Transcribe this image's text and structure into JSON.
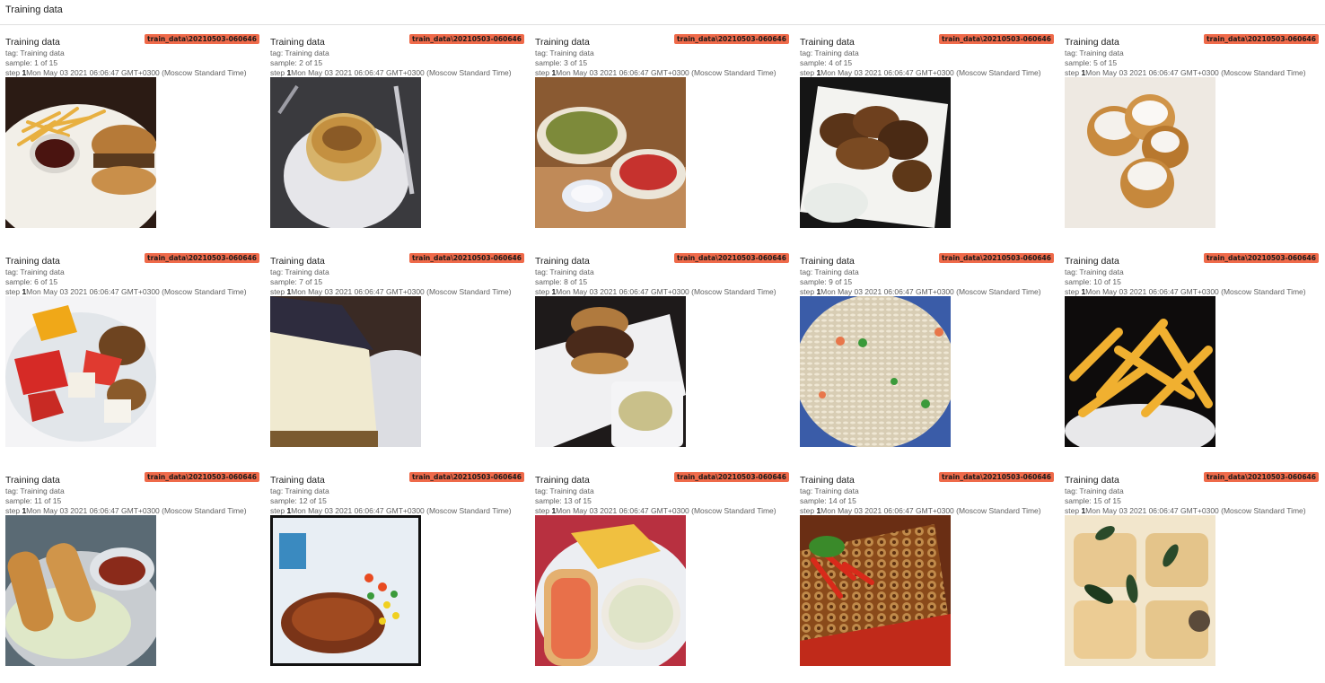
{
  "page": {
    "title": "Training data"
  },
  "cards": [
    {
      "title": "Training data",
      "run": "train_data\\20210503-060646",
      "tag": "tag: Training data",
      "sample": "sample: 1 of 15",
      "step_label": "step ",
      "step_value": "1",
      "timestamp": "Mon May 03 2021 06:06:47 GMT+0300 (Moscow Standard Time)",
      "image": "burger-and-fries-image"
    },
    {
      "title": "Training data",
      "run": "train_data\\20210503-060646",
      "tag": "tag: Training data",
      "sample": "sample: 2 of 15",
      "step_label": "step ",
      "step_value": "1",
      "timestamp": "Mon May 03 2021 06:06:47 GMT+0300 (Moscow Standard Time)",
      "image": "onion-soup-image"
    },
    {
      "title": "Training data",
      "run": "train_data\\20210503-060646",
      "tag": "tag: Training data",
      "sample": "sample: 3 of 15",
      "step_label": "step ",
      "step_value": "1",
      "timestamp": "Mon May 03 2021 06:06:47 GMT+0300 (Moscow Standard Time)",
      "image": "salsa-dishes-image"
    },
    {
      "title": "Training data",
      "run": "train_data\\20210503-060646",
      "tag": "tag: Training data",
      "sample": "sample: 4 of 15",
      "step_label": "step ",
      "step_value": "1",
      "timestamp": "Mon May 03 2021 06:06:47 GMT+0300 (Moscow Standard Time)",
      "image": "chicken-wings-image"
    },
    {
      "title": "Training data",
      "run": "train_data\\20210503-060646",
      "tag": "tag: Training data",
      "sample": "sample: 5 of 15",
      "step_label": "step ",
      "step_value": "1",
      "timestamp": "Mon May 03 2021 06:06:47 GMT+0300 (Moscow Standard Time)",
      "image": "beignets-image"
    },
    {
      "title": "Training data",
      "run": "train_data\\20210503-060646",
      "tag": "tag: Training data",
      "sample": "sample: 6 of 15",
      "step_label": "step ",
      "step_value": "1",
      "timestamp": "Mon May 03 2021 06:06:47 GMT+0300 (Moscow Standard Time)",
      "image": "fruit-salad-image"
    },
    {
      "title": "Training data",
      "run": "train_data\\20210503-060646",
      "tag": "tag: Training data",
      "sample": "sample: 7 of 15",
      "step_label": "step ",
      "step_value": "1",
      "timestamp": "Mon May 03 2021 06:06:47 GMT+0300 (Moscow Standard Time)",
      "image": "cheesecake-image"
    },
    {
      "title": "Training data",
      "run": "train_data\\20210503-060646",
      "tag": "tag: Training data",
      "sample": "sample: 8 of 15",
      "step_label": "step ",
      "step_value": "1",
      "timestamp": "Mon May 03 2021 06:06:47 GMT+0300 (Moscow Standard Time)",
      "image": "pulled-pork-sandwich-image"
    },
    {
      "title": "Training data",
      "run": "train_data\\20210503-060646",
      "tag": "tag: Training data",
      "sample": "sample: 9 of 15",
      "step_label": "step ",
      "step_value": "1",
      "timestamp": "Mon May 03 2021 06:06:47 GMT+0300 (Moscow Standard Time)",
      "image": "fried-rice-image"
    },
    {
      "title": "Training data",
      "run": "train_data\\20210503-060646",
      "tag": "tag: Training data",
      "sample": "sample: 10 of 15",
      "step_label": "step ",
      "step_value": "1",
      "timestamp": "Mon May 03 2021 06:06:47 GMT+0300 (Moscow Standard Time)",
      "image": "french-fries-image"
    },
    {
      "title": "Training data",
      "run": "train_data\\20210503-060646",
      "tag": "tag: Training data",
      "sample": "sample: 11 of 15",
      "step_label": "step ",
      "step_value": "1",
      "timestamp": "Mon May 03 2021 06:06:47 GMT+0300 (Moscow Standard Time)",
      "image": "spring-rolls-image"
    },
    {
      "title": "Training data",
      "run": "train_data\\20210503-060646",
      "tag": "tag: Training data",
      "sample": "sample: 12 of 15",
      "step_label": "step ",
      "step_value": "1",
      "timestamp": "Mon May 03 2021 06:06:47 GMT+0300 (Moscow Standard Time)",
      "image": "grilled-chicken-image"
    },
    {
      "title": "Training data",
      "run": "train_data\\20210503-060646",
      "tag": "tag: Training data",
      "sample": "sample: 13 of 15",
      "step_label": "step ",
      "step_value": "1",
      "timestamp": "Mon May 03 2021 06:06:47 GMT+0300 (Moscow Standard Time)",
      "image": "lobster-roll-image"
    },
    {
      "title": "Training data",
      "run": "train_data\\20210503-060646",
      "tag": "tag: Training data",
      "sample": "sample: 14 of 15",
      "step_label": "step ",
      "step_value": "1",
      "timestamp": "Mon May 03 2021 06:06:47 GMT+0300 (Moscow Standard Time)",
      "image": "escargot-image"
    },
    {
      "title": "Training data",
      "run": "train_data\\20210503-060646",
      "tag": "tag: Training data",
      "sample": "sample: 15 of 15",
      "step_label": "step ",
      "step_value": "1",
      "timestamp": "Mon May 03 2021 06:06:47 GMT+0300 (Moscow Standard Time)",
      "image": "ravioli-image"
    }
  ]
}
